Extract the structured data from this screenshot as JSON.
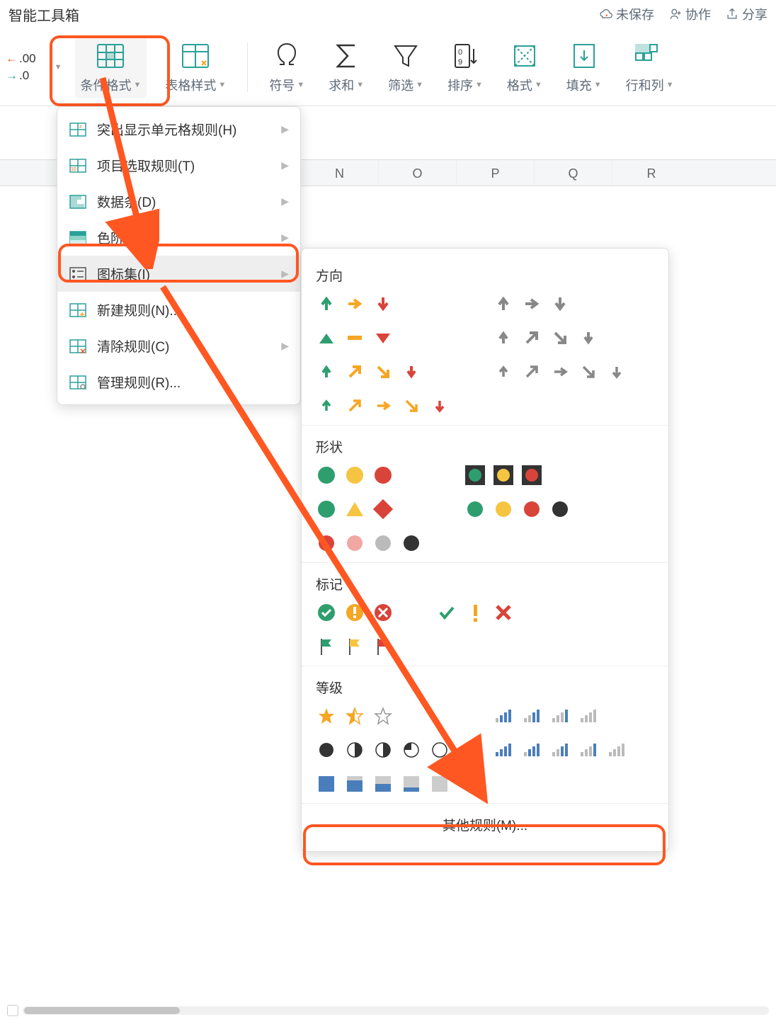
{
  "topbar": {
    "title_frag": "智能工具箱",
    "unsaved": "未保存",
    "collab": "协作",
    "share": "分享"
  },
  "ribbon": {
    "dec_inc": ".00",
    "dec_dec": ".0",
    "conditional_format": "条件格式",
    "table_style": "表格样式",
    "symbol": "符号",
    "sum": "求和",
    "filter": "筛选",
    "sort": "排序",
    "format": "格式",
    "fill": "填充",
    "rows_cols": "行和列"
  },
  "menu1": {
    "highlight": "突出显示单元格规则(H)",
    "topbottom": "项目选取规则(T)",
    "databars": "数据条(D)",
    "colorscales": "色阶(S)",
    "iconsets": "图标集(I)",
    "newrule": "新建规则(N)...",
    "clear": "清除规则(C)",
    "manage": "管理规则(R)..."
  },
  "menu2": {
    "direction": "方向",
    "shapes": "形状",
    "indicators": "标记",
    "ratings": "等级",
    "more": "其他规则(M)..."
  },
  "columns": [
    "N",
    "O",
    "P",
    "Q",
    "R"
  ]
}
